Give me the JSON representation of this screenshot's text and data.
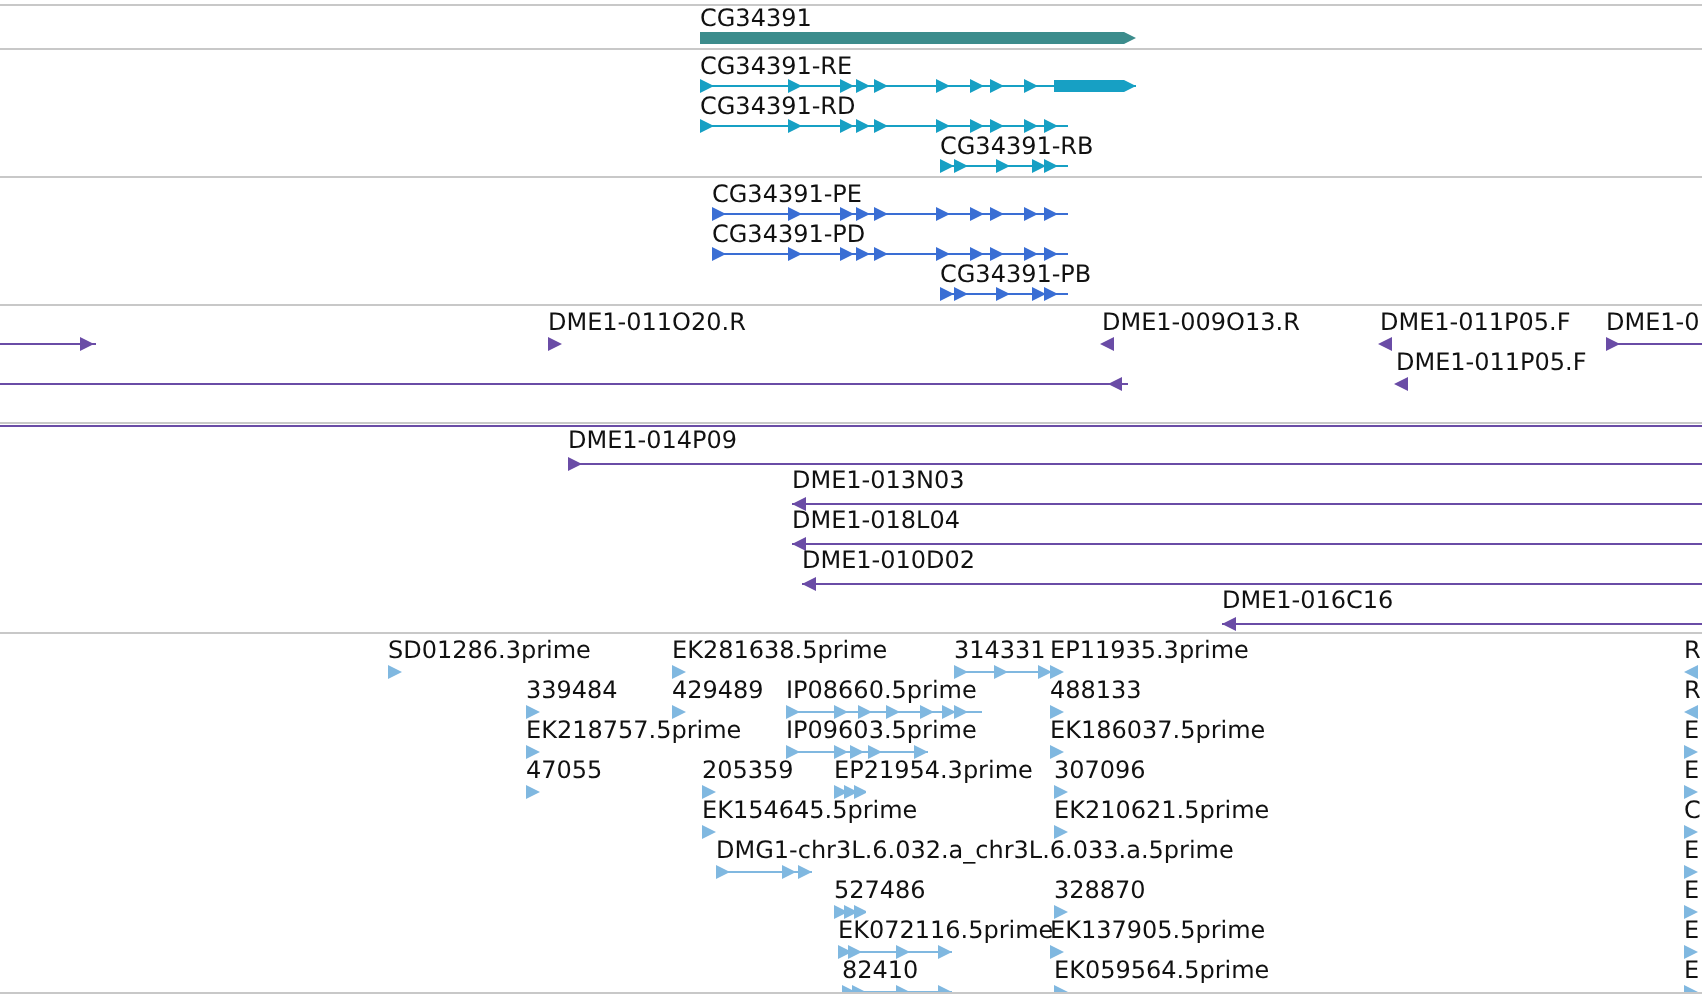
{
  "tracks": [
    {
      "color": "#3c8c8c",
      "features": [
        {
          "kind": "gene",
          "label": "CG34391",
          "reverse": false
        }
      ]
    },
    {
      "color": "#17a0c4",
      "features": [
        {
          "kind": "transcript",
          "label": "CG34391-RE",
          "reverse": false
        },
        {
          "kind": "transcript",
          "label": "CG34391-RD",
          "reverse": false
        },
        {
          "kind": "transcript",
          "label": "CG34391-RB",
          "reverse": false
        }
      ]
    },
    {
      "color": "#3a6ed4",
      "features": [
        {
          "kind": "transcript",
          "label": "CG34391-PE",
          "reverse": false
        },
        {
          "kind": "transcript",
          "label": "CG34391-PD",
          "reverse": false
        },
        {
          "kind": "transcript",
          "label": "CG34391-PB",
          "reverse": false
        }
      ]
    },
    {
      "color": "#6a4ca6",
      "features": [
        {
          "kind": "clone",
          "reverse": false
        },
        {
          "kind": "clone",
          "label": "DME1-011O20.R",
          "reverse": false
        },
        {
          "kind": "clone",
          "label": "DME1-009O13.R",
          "reverse": true
        },
        {
          "kind": "clone",
          "label": "DME1-011P05.F",
          "reverse": true
        },
        {
          "kind": "clone",
          "label": "DME1-011P05.F",
          "reverse": true
        },
        {
          "kind": "clone",
          "label": "DME1-0",
          "reverse": false
        },
        {
          "kind": "clone",
          "reverse": true
        }
      ]
    },
    {
      "color": "#6a4ca6",
      "features": [
        {
          "kind": "clone"
        },
        {
          "kind": "clone",
          "label": "DME1-014P09",
          "reverse": false
        },
        {
          "kind": "clone",
          "label": "DME1-013N03",
          "reverse": true
        },
        {
          "kind": "clone",
          "label": "DME1-018L04",
          "reverse": true
        },
        {
          "kind": "clone",
          "label": "DME1-010D02",
          "reverse": true
        },
        {
          "kind": "clone",
          "label": "DME1-016C16",
          "reverse": true
        }
      ]
    },
    {
      "color": "#80b8e0",
      "features": [
        {
          "kind": "est",
          "label": "SD01286.3prime",
          "reverse": false
        },
        {
          "kind": "est",
          "label": "EK281638.5prime",
          "reverse": false
        },
        {
          "kind": "est",
          "label": "314331",
          "reverse": false
        },
        {
          "kind": "est",
          "label": "EP11935.3prime",
          "reverse": false
        },
        {
          "kind": "est",
          "label": "R",
          "reverse": true
        },
        {
          "kind": "est",
          "label": "339484",
          "reverse": false
        },
        {
          "kind": "est",
          "label": "429489",
          "reverse": false
        },
        {
          "kind": "est",
          "label": "IP08660.5prime",
          "reverse": false
        },
        {
          "kind": "est",
          "label": "488133",
          "reverse": false
        },
        {
          "kind": "est",
          "label": "R",
          "reverse": true
        },
        {
          "kind": "est",
          "label": "EK218757.5prime",
          "reverse": false
        },
        {
          "kind": "est",
          "label": "IP09603.5prime",
          "reverse": false
        },
        {
          "kind": "est",
          "label": "EK186037.5prime",
          "reverse": false
        },
        {
          "kind": "est",
          "label": "E",
          "reverse": false
        },
        {
          "kind": "est",
          "label": "47055",
          "reverse": false
        },
        {
          "kind": "est",
          "label": "205359",
          "reverse": false
        },
        {
          "kind": "est",
          "label": "EP21954.3prime",
          "reverse": false
        },
        {
          "kind": "est",
          "label": "307096",
          "reverse": false
        },
        {
          "kind": "est",
          "label": "E",
          "reverse": false
        },
        {
          "kind": "est",
          "label": "EK154645.5prime",
          "reverse": false
        },
        {
          "kind": "est",
          "label": "EK210621.5prime",
          "reverse": false
        },
        {
          "kind": "est",
          "label": "C",
          "reverse": false
        },
        {
          "kind": "est",
          "label": "DMG1-chr3L.6.032.a_chr3L.6.033.a.5prime",
          "reverse": false
        },
        {
          "kind": "est",
          "label": "E",
          "reverse": false
        },
        {
          "kind": "est",
          "label": "527486",
          "reverse": false
        },
        {
          "kind": "est",
          "label": "328870",
          "reverse": false
        },
        {
          "kind": "est",
          "label": "E",
          "reverse": false
        },
        {
          "kind": "est",
          "label": "EK072116.5prime",
          "reverse": false
        },
        {
          "kind": "est",
          "label": "EK137905.5prime",
          "reverse": false
        },
        {
          "kind": "est",
          "label": "E",
          "reverse": false
        },
        {
          "kind": "est",
          "label": "82410",
          "reverse": false
        },
        {
          "kind": "est",
          "label": "EK059564.5prime",
          "reverse": false
        },
        {
          "kind": "est",
          "label": "E",
          "reverse": false
        }
      ]
    }
  ]
}
